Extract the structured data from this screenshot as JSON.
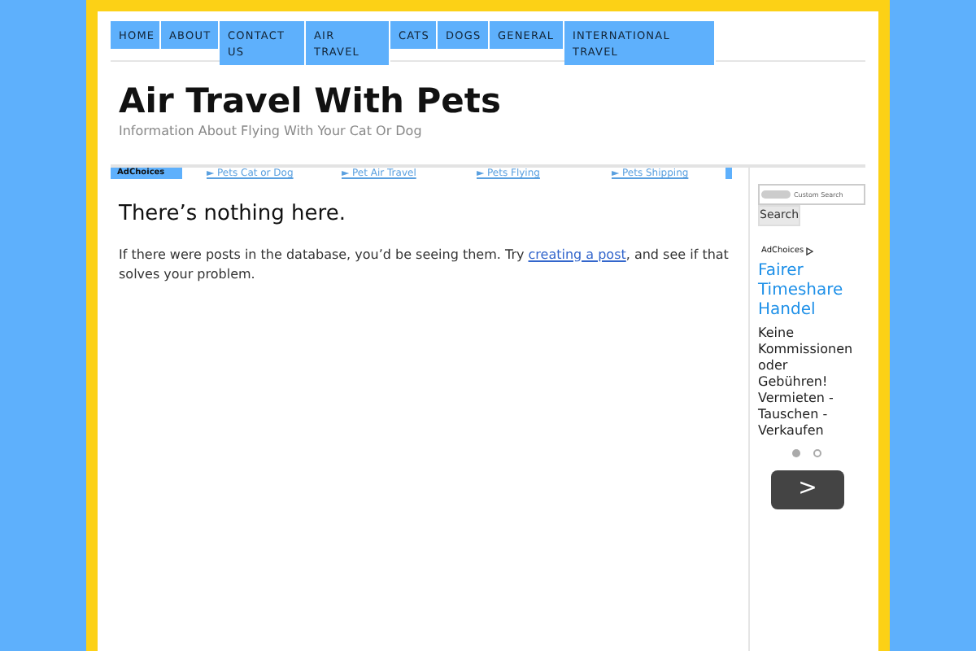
{
  "nav": [
    "HOME",
    "ABOUT",
    "CONTACT US",
    "AIR TRAVEL",
    "CATS",
    "DOGS",
    "GENERAL",
    "INTERNATIONAL TRAVEL"
  ],
  "site": {
    "title": "Air Travel With Pets",
    "tagline": "Information About Flying With Your Cat Or Dog"
  },
  "ad_links": {
    "badge": "AdChoices",
    "links": [
      "► Pets Cat or Dog",
      "► Pet Air Travel",
      "► Pets Flying",
      "► Pets Shipping"
    ]
  },
  "post": {
    "heading": "There’s nothing here.",
    "text_before": "If there were posts in the database, you’d be seeing them. Try ",
    "link": "creating a post",
    "text_after": ", and see if that solves your problem."
  },
  "sidebar": {
    "search_placeholder": "Custom Search",
    "search_button": "Search",
    "ad_badge": "AdChoices",
    "ad_title": "Fairer Timeshare Handel",
    "ad_text": "Keine Kommissionen oder Gebühren! Vermieten - Tauschen - Verkaufen",
    "dots": [
      {
        "selected": true
      },
      {
        "selected": false
      }
    ],
    "next": ">"
  }
}
